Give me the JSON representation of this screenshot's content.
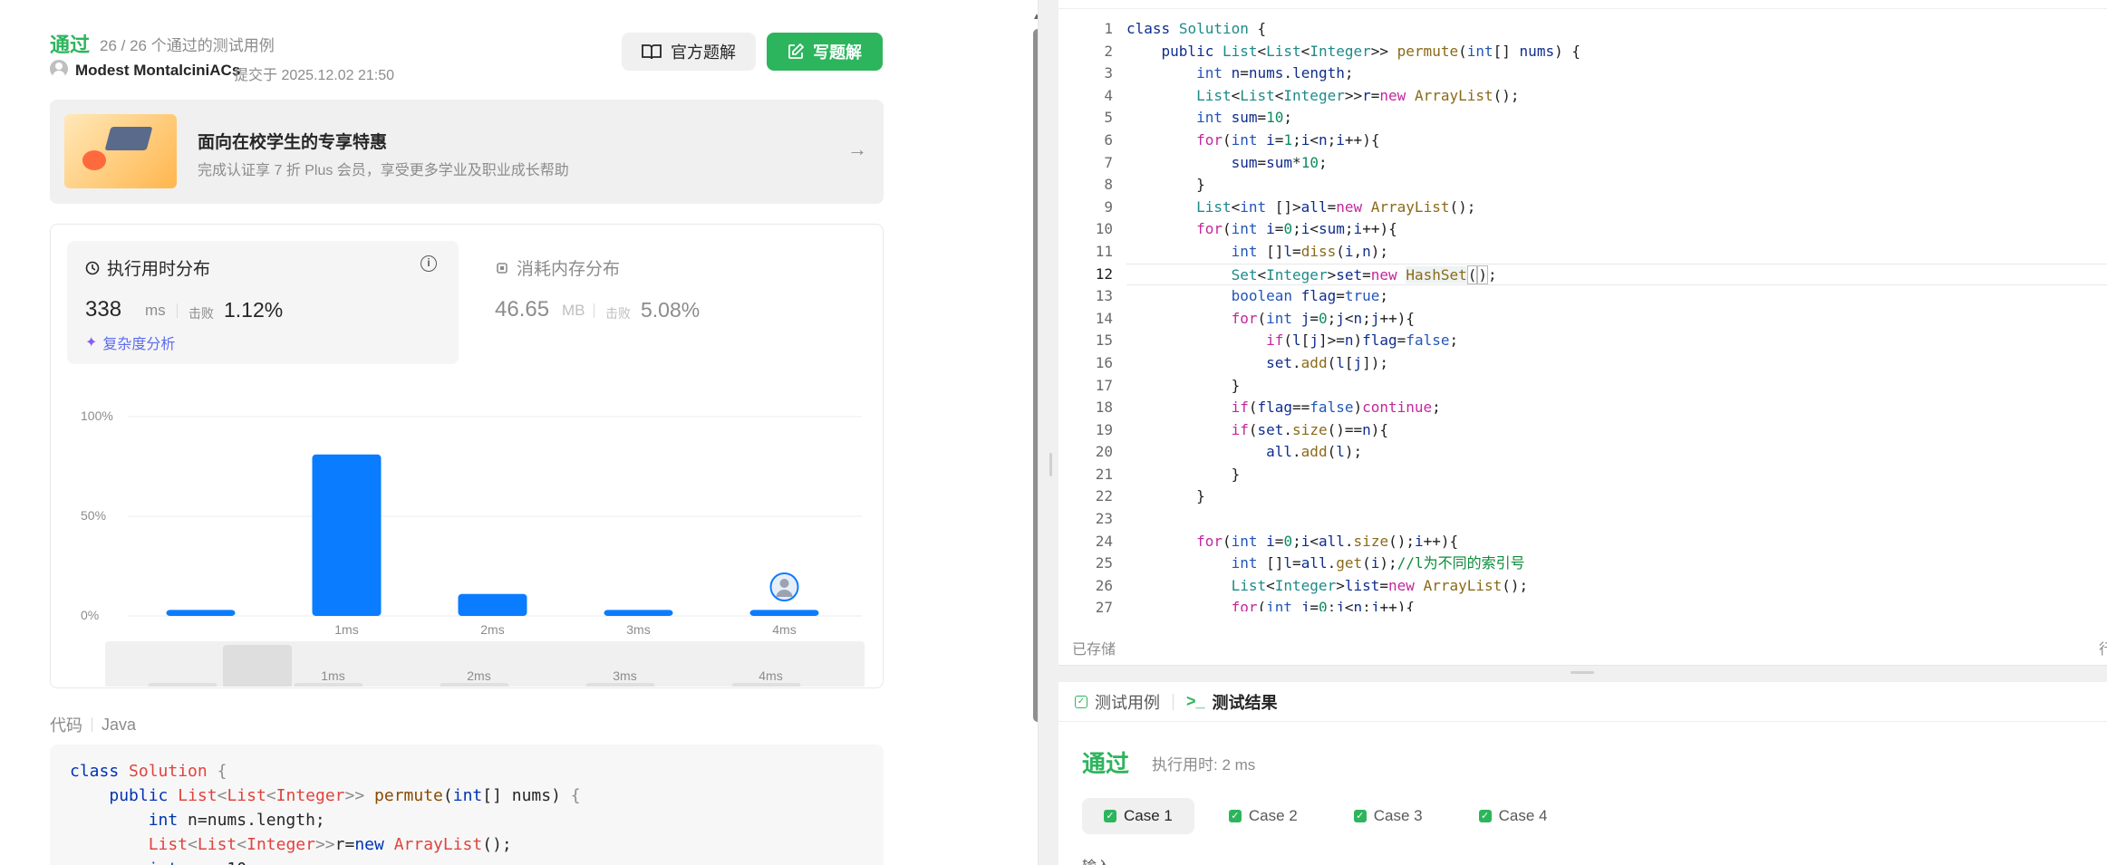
{
  "left": {
    "status": "通过",
    "tests_passed": "26 / 26 个通过的测试用例",
    "user_name": "Modest MontalciniACs",
    "submit_info": "提交于 2025.12.02 21:50",
    "btn_official": "官方题解",
    "btn_write": "写题解",
    "banner_title": "面向在校学生的专享特惠",
    "banner_sub": "完成认证享 7 折 Plus 会员，享受更多学业及职业成长帮助",
    "time_title": "执行用时分布",
    "time_value": "338",
    "time_unit": "ms",
    "beat_label": "击败",
    "time_beat": "1.12%",
    "complexity": "复杂度分析",
    "mem_title": "消耗内存分布",
    "mem_value": "46.65",
    "mem_unit": "MB",
    "mem_beat": "5.08%",
    "code_label": "代码",
    "code_lang": "Java"
  },
  "chart_data": {
    "type": "bar",
    "categories": [
      "",
      "1ms",
      "2ms",
      "3ms",
      "4ms"
    ],
    "values": [
      3,
      81,
      11,
      3,
      3
    ],
    "ylim": [
      0,
      100
    ],
    "yticks": [
      "100%",
      "50%",
      "0%"
    ],
    "brush_labels": [
      "1ms",
      "2ms",
      "3ms",
      "4ms"
    ],
    "bar_color": "#0a7cff"
  },
  "colors": {
    "accent_green": "#2db55d",
    "bar_blue": "#0a7cff"
  },
  "editor": {
    "saved": "已存储",
    "row_label": "行"
  },
  "results": {
    "tab_cases": "测试用例",
    "tab_result": "测试结果",
    "status": "通过",
    "time": "执行用时: 2 ms",
    "cases": [
      "Case 1",
      "Case 2",
      "Case 3",
      "Case 4"
    ],
    "input_label": "输入"
  }
}
